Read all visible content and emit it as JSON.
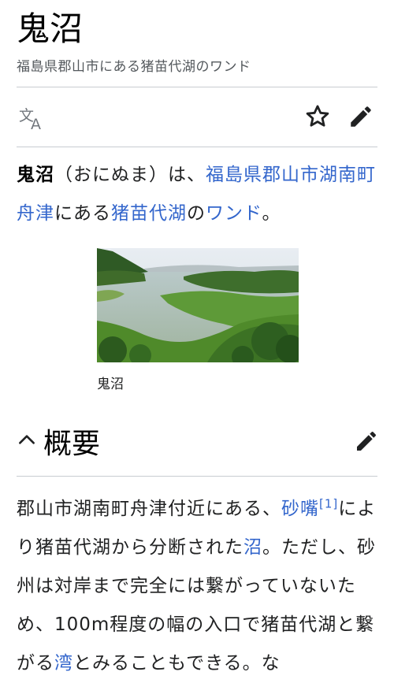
{
  "article": {
    "title": "鬼沼",
    "subtitle": "福島県郡山市にある猪苗代湖のワンド"
  },
  "icons": {
    "language": "language-icon",
    "watch": "star-icon",
    "edit": "pencil-icon",
    "collapse": "chevron-up-icon",
    "section_edit": "pencil-icon"
  },
  "lead": {
    "bold": "鬼沼",
    "t1": "（おにぬま）は、",
    "link1": "福島県郡山市湖南町舟津",
    "t2": "にある",
    "link2": "猪苗代湖",
    "t3": "の",
    "link3": "ワンド",
    "t4": "。"
  },
  "figure": {
    "caption": "鬼沼"
  },
  "section": {
    "title": "概要",
    "t1": "郡山市湖南町舟津付近にある、",
    "link1": "砂嘴",
    "ref": "[1]",
    "t2": "により猪苗代湖から分断された",
    "link2": "沼",
    "t3": "。ただし、砂州は対岸まで完全には繋がっていないため、100m程度の幅の入口で猪苗代湖と繋がる",
    "link3": "湾",
    "t4": "とみることもできる。な"
  },
  "colors": {
    "link": "#3366cc",
    "text": "#202122",
    "muted": "#54595d",
    "icon": "#202122",
    "divider": "#c8ccd1"
  }
}
